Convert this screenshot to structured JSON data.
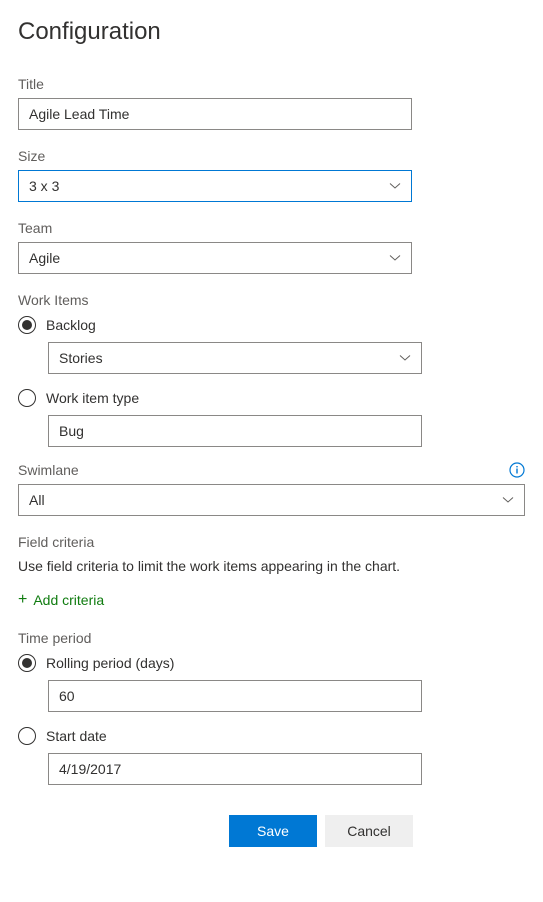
{
  "header": {
    "title": "Configuration"
  },
  "fields": {
    "title": {
      "label": "Title",
      "value": "Agile Lead Time"
    },
    "size": {
      "label": "Size",
      "value": "3 x 3"
    },
    "team": {
      "label": "Team",
      "value": "Agile"
    }
  },
  "workItems": {
    "heading": "Work Items",
    "backlog": {
      "label": "Backlog",
      "value": "Stories"
    },
    "workItemType": {
      "label": "Work item type",
      "value": "Bug"
    }
  },
  "swimlane": {
    "label": "Swimlane",
    "value": "All"
  },
  "fieldCriteria": {
    "heading": "Field criteria",
    "helper": "Use field criteria to limit the work items appearing in the chart.",
    "addLabel": "Add criteria"
  },
  "timePeriod": {
    "heading": "Time period",
    "rolling": {
      "label": "Rolling period (days)",
      "value": "60"
    },
    "startDate": {
      "label": "Start date",
      "value": "4/19/2017"
    }
  },
  "buttons": {
    "save": "Save",
    "cancel": "Cancel"
  }
}
